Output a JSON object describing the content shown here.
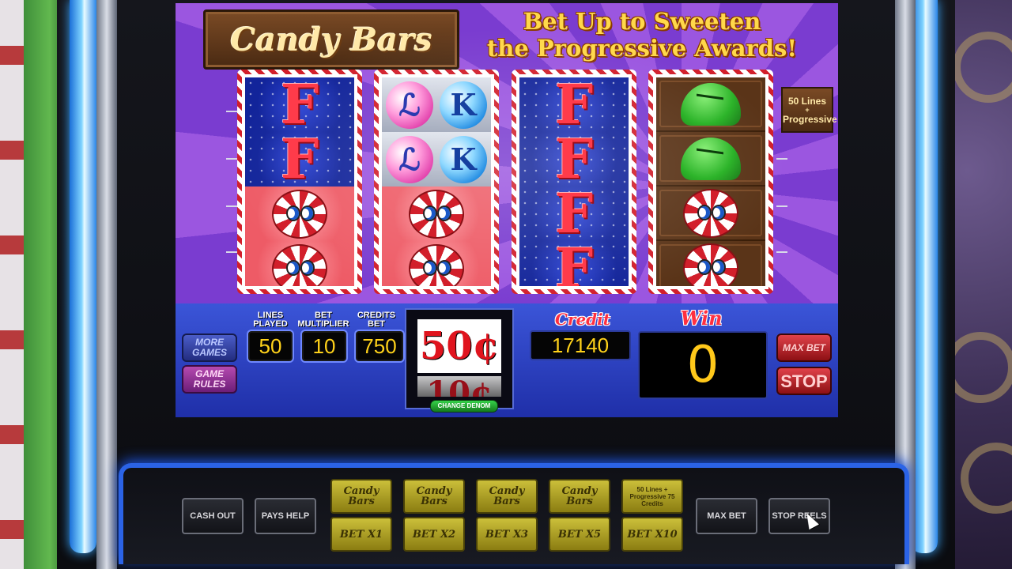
{
  "game": {
    "logo_text": "Candy Bars",
    "promo_line1": "Bet Up to Sweeten",
    "promo_line2": "the Progressive Awards!",
    "paylines_badge_line1": "50 Lines",
    "paylines_badge_plus": "+",
    "paylines_badge_line2": "Progressive"
  },
  "reels": [
    {
      "symbols": [
        "fireball",
        "fireball",
        "peppermint",
        "peppermint"
      ]
    },
    {
      "symbols": [
        "lollipop",
        "lollipop",
        "peppermint",
        "peppermint"
      ]
    },
    {
      "symbols": [
        "fireball",
        "fireball",
        "fireball",
        "fireball"
      ]
    },
    {
      "symbols": [
        "gumdrop",
        "gumdrop",
        "peppermint",
        "peppermint"
      ]
    }
  ],
  "hud": {
    "more_games": "MORE GAMES",
    "game_rules": "GAME RULES",
    "lines_played_label": "LINES PLAYED",
    "lines_played_value": "50",
    "bet_multiplier_label": "BET MULTIPLIER",
    "bet_multiplier_value": "10",
    "credits_bet_label": "CREDITS BET",
    "credits_bet_value": "750",
    "denomination": "50¢",
    "next_denomination": "10¢",
    "change_denom": "CHANGE DENOM",
    "credit_label": "Credit",
    "credit_value": "17140",
    "win_label": "Win",
    "win_value": "0",
    "max_bet": "MAX BET",
    "stop": "STOP"
  },
  "deck": {
    "cash_out": "CASH OUT",
    "pays_help": "PAYS HELP",
    "max_bet": "MAX BET",
    "stop_reels": "STOP REELS",
    "top_row": [
      "Candy Bars",
      "Candy Bars",
      "Candy Bars",
      "Candy Bars"
    ],
    "top_row_last": "50 Lines + Progressive 75 Credits",
    "bet_row": [
      "BET X1",
      "BET X2",
      "BET X3",
      "BET X5",
      "BET X10"
    ]
  },
  "colors": {
    "accent_blue": "#2b63e6",
    "credit_digits": "#ffd21a",
    "title_red": "#ff3040"
  }
}
